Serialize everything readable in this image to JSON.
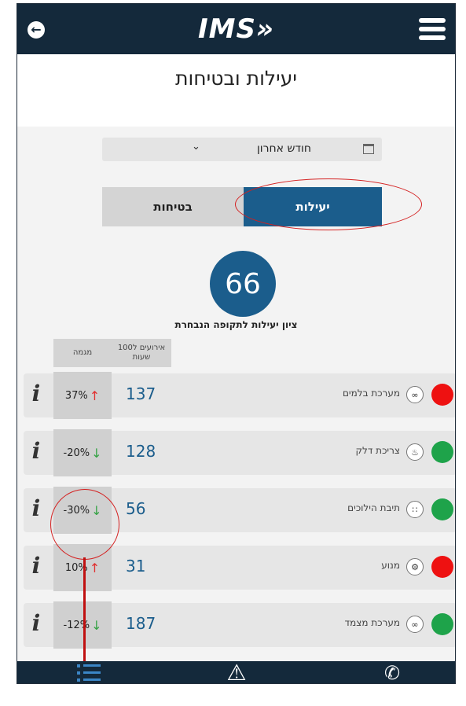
{
  "header": {
    "logo_text": "IMS»",
    "back_icon": "arrow-left-icon",
    "menu_icon": "hamburger-icon"
  },
  "page": {
    "title": "יעילות ובטיחות"
  },
  "period_select": {
    "value": "חודש אחרון",
    "icon": "calendar-icon"
  },
  "tabs": [
    {
      "label": "בטיחות",
      "selected": false
    },
    {
      "label": "יעילות",
      "selected": true
    }
  ],
  "score": {
    "value": "66",
    "label": "ציון יעילות לתקופה הנבחרת"
  },
  "columns": {
    "trend": "מגמה",
    "events_line1": "אירועים ל100",
    "events_line2": "שעות"
  },
  "rows": [
    {
      "name": "מערכת בלמים",
      "value": "137",
      "trend": "37%",
      "direction": "up",
      "status": "red",
      "icon": "brakes-icon"
    },
    {
      "name": "צריכת דלק",
      "value": "128",
      "trend": "-20%",
      "direction": "down",
      "status": "green",
      "icon": "fuel-icon"
    },
    {
      "name": "תיבת הילוכים",
      "value": "56",
      "trend": "-30%",
      "direction": "down",
      "status": "green",
      "icon": "gearbox-icon"
    },
    {
      "name": "מנוע",
      "value": "31",
      "trend": "10%",
      "direction": "up",
      "status": "red",
      "icon": "engine-icon"
    },
    {
      "name": "מערכת מצמד",
      "value": "187",
      "trend": "-12%",
      "direction": "down",
      "status": "green",
      "icon": "clutch-icon"
    }
  ],
  "colors": {
    "navy": "#14293b",
    "accent_blue": "#1b5d8c",
    "status_red": "#ee1111",
    "status_green": "#1ea34a",
    "annotation_red": "#d42020"
  },
  "bottom_nav": [
    {
      "icon": "list-icon",
      "selected": true
    },
    {
      "icon": "warning-icon",
      "selected": false
    },
    {
      "icon": "phone-icon",
      "selected": false
    }
  ]
}
